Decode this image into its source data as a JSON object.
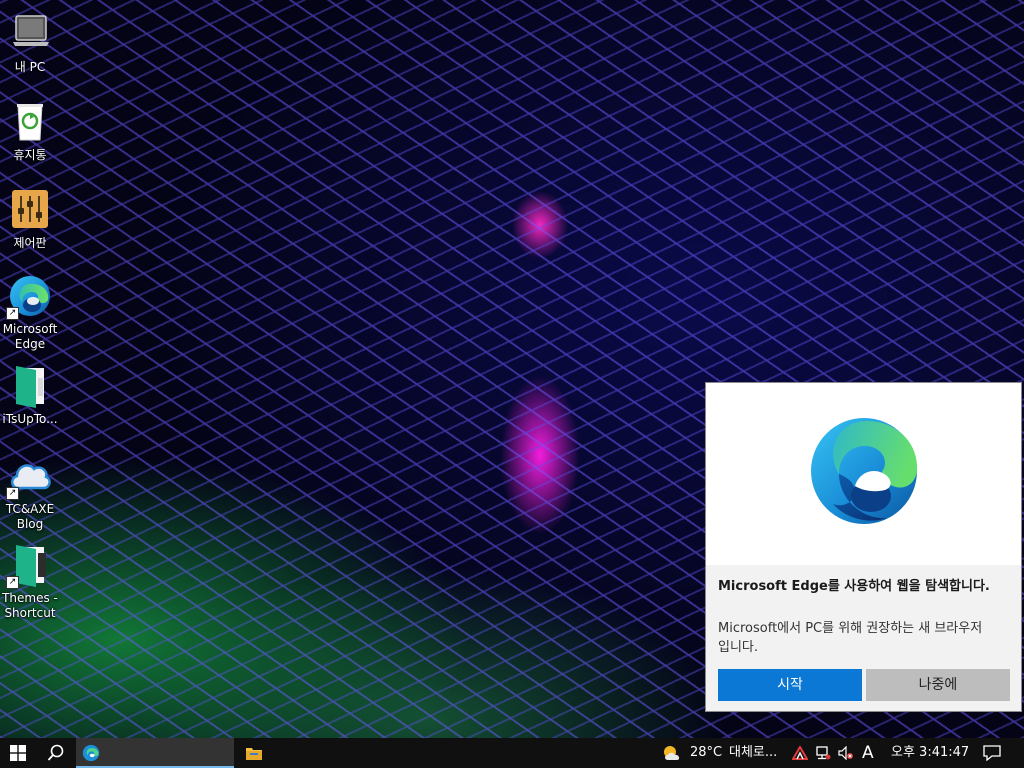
{
  "desktop": {
    "icons": [
      {
        "id": "this-pc",
        "label": "내 PC",
        "icon": "laptop-icon",
        "shortcut": false
      },
      {
        "id": "recycle-bin",
        "label": "휴지통",
        "icon": "recycle-bin-icon",
        "shortcut": false
      },
      {
        "id": "control-panel",
        "label": "제어판",
        "icon": "control-panel-icon",
        "shortcut": false
      },
      {
        "id": "edge",
        "label": "Microsoft Edge",
        "icon": "edge-icon",
        "shortcut": true
      },
      {
        "id": "itsupto",
        "label": "iTsUpTo...",
        "icon": "book-icon",
        "shortcut": false
      },
      {
        "id": "blog",
        "label": "TC&AXE Blog",
        "icon": "cloud-icon",
        "shortcut": true
      },
      {
        "id": "themes",
        "label": "Themes - Shortcut",
        "icon": "book-icon",
        "shortcut": true
      }
    ]
  },
  "toast": {
    "title": "Microsoft Edge를 사용하여 웹을 탐색합니다.",
    "body": "Microsoft에서 PC를 위해 권장하는 새 브라우저입니다.",
    "primary_label": "시작",
    "secondary_label": "나중에",
    "icon": "edge-logo-icon"
  },
  "taskbar": {
    "weather_temp": "28°C",
    "weather_desc": "대체로...",
    "ime_indicator": "A",
    "clock": "오후 3:41:47"
  },
  "colors": {
    "accent": "#0a78d4",
    "taskbar": "#101010"
  }
}
